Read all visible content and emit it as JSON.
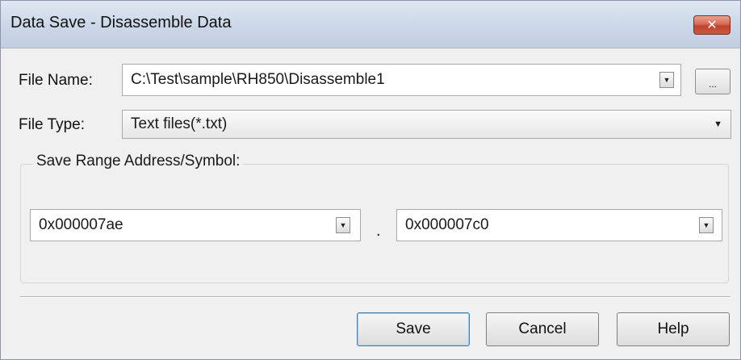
{
  "window": {
    "title": "Data Save - Disassemble Data",
    "close_label": "✕"
  },
  "file_name": {
    "label": "File Name:",
    "value": "C:\\Test\\sample\\RH850\\Disassemble1",
    "browse_label": "..."
  },
  "file_type": {
    "label": "File Type:",
    "value": "Text files(*.txt)"
  },
  "save_range": {
    "legend": "Save Range Address/Symbol:",
    "start": "0x000007ae",
    "separator": ".",
    "end": "0x000007c0"
  },
  "buttons": {
    "save": "Save",
    "cancel": "Cancel",
    "help": "Help"
  }
}
